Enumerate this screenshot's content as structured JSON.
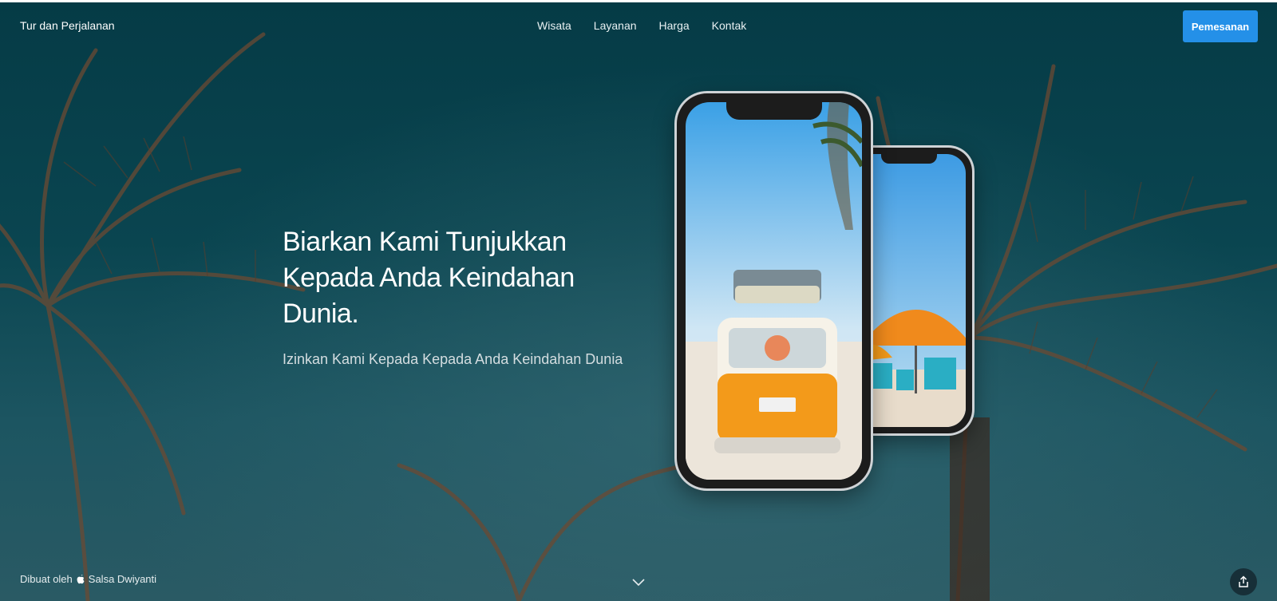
{
  "header": {
    "brand": "Tur dan Perjalanan",
    "nav": [
      {
        "label": "Wisata"
      },
      {
        "label": "Layanan"
      },
      {
        "label": "Harga"
      },
      {
        "label": "Kontak"
      }
    ],
    "cta_label": "Pemesanan"
  },
  "hero": {
    "title": "Biarkan Kami Tunjukkan Kepada Anda Keindahan Dunia.",
    "subtitle": "Izinkan Kami Kepada Kepada Anda Keindahan Dunia"
  },
  "footer": {
    "credit_prefix": "Dibuat oleh",
    "credit_name": "Salsa Dwiyanti"
  },
  "icons": {
    "credit": "apple-icon",
    "scroll": "chevron-down-icon",
    "share": "share-icon"
  },
  "colors": {
    "background": "#0a4550",
    "cta": "#2490e8",
    "van": "#f39a1a"
  }
}
